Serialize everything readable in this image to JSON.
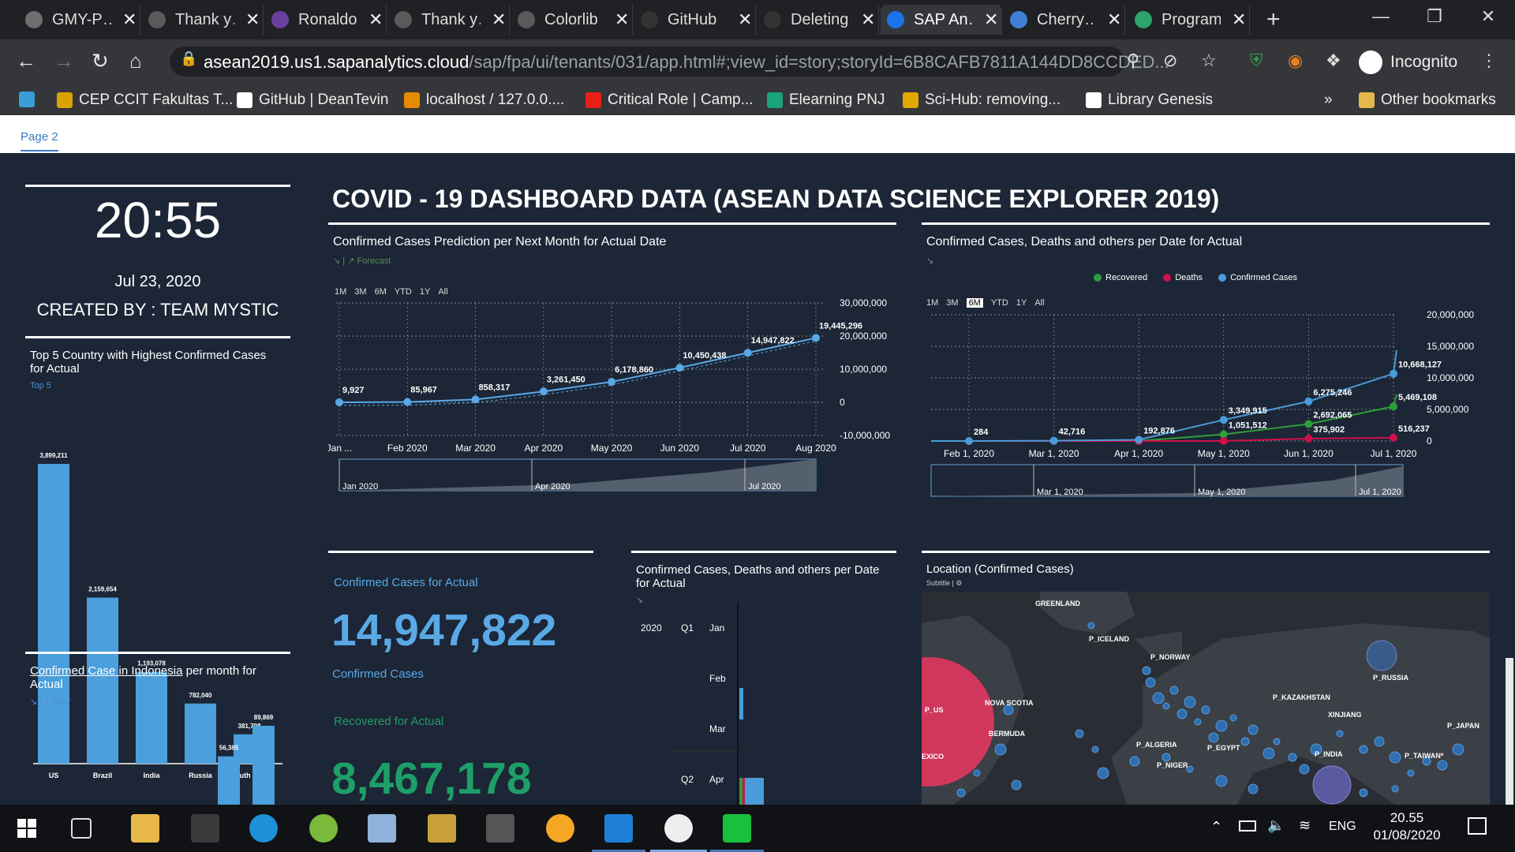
{
  "tabs": [
    {
      "title": "GMY-P…",
      "color": "#6e6e6e"
    },
    {
      "title": "Thank y…",
      "color": "#5a5a5a"
    },
    {
      "title": "Ronaldo…",
      "color": "#6b3fa0"
    },
    {
      "title": "Thank y…",
      "color": "#5a5a5a"
    },
    {
      "title": "Colorlib",
      "color": "#5a5a5a"
    },
    {
      "title": "GitHub",
      "color": "#333"
    },
    {
      "title": "Deleting…",
      "color": "#333"
    },
    {
      "title": "SAP An…",
      "color": "#1a73e8"
    },
    {
      "title": "Cherry…",
      "color": "#3f7fd6"
    },
    {
      "title": "Program…",
      "color": "#2ea36b"
    }
  ],
  "browser": {
    "url_host": "asean2019.us1.sapanalytics.cloud",
    "url_path": "/sap/fpa/ui/tenants/031/app.html#;view_id=story;storyId=6B8CAFB7811A144DD8CCDED...",
    "profile": "Incognito"
  },
  "bookmarks": [
    {
      "label": "CEP CCIT Fakultas T...",
      "color": "#d8a300"
    },
    {
      "label": "GitHub | DeanTevin",
      "color": "#ffffff"
    },
    {
      "label": "localhost / 127.0.0....",
      "color": "#e58b00"
    },
    {
      "label": "Critical Role | Camp...",
      "color": "#e62117"
    },
    {
      "label": "Elearning PNJ",
      "color": "#1aa37a"
    },
    {
      "label": "Sci-Hub: removing...",
      "color": "#e0a800"
    },
    {
      "label": "Library Genesis",
      "color": "#ffffff"
    }
  ],
  "bookmarks_more": "»",
  "other_bookmarks": "Other bookmarks",
  "page_tab": "Page 2",
  "dashboard": {
    "clock": "20:55",
    "date": "Jul 23, 2020",
    "created_by": "CREATED BY : TEAM MYSTIC",
    "title": "COVID - 19 DASHBOARD DATA (ASEAN DATA SCIENCE EXPLORER 2019)",
    "top5": {
      "title": "Top 5 Country with Highest Confirmed Cases for Actual",
      "link": "Top 5"
    },
    "indonesia": {
      "title_link": "Confirmed Case in Indonesia",
      "title_rest": " per month for Actual",
      "filter": "1 Filter"
    },
    "prediction": {
      "title": "Confirmed Cases Prediction per Next Month for Actual Date",
      "forecast": "Forecast",
      "ranges": [
        "1M",
        "3M",
        "6M",
        "YTD",
        "1Y",
        "All"
      ]
    },
    "cdo": {
      "title": "Confirmed Cases, Deaths and others per Date for Actual",
      "ranges": [
        "1M",
        "3M",
        "6M",
        "YTD",
        "1Y",
        "All"
      ],
      "selected_range": "6M"
    },
    "kpi": {
      "confirmed_title": "Confirmed Cases for Actual",
      "confirmed_value": "14,947,822",
      "confirmed_label": "Confirmed Cases",
      "recovered_title": "Recovered for Actual",
      "recovered_value": "8,467,178"
    },
    "small_cdo": {
      "title": "Confirmed Cases, Deaths and others per Date for Actual",
      "rows": [
        {
          "year": "2020",
          "q": "Q1",
          "m": "Jan"
        },
        {
          "year": "",
          "q": "",
          "m": "Feb"
        },
        {
          "year": "",
          "q": "",
          "m": "Mar"
        },
        {
          "year": "",
          "q": "Q2",
          "m": "Apr"
        }
      ]
    },
    "map": {
      "title": "Location (Confirmed Cases)",
      "subtitle": "Subtitle",
      "labels": [
        "GREENLAND",
        "P_ICELAND",
        "P_NORWAY",
        "P_RUSSIA",
        "NOVA SCOTIA",
        "P_US",
        "BERMUDA",
        "P_KAZAKHSTAN",
        "XINJIANG",
        "P_JAPAN",
        "P_ALGERIA",
        "P_EGYPT",
        "P_INDIA",
        "P_TAIWAN*",
        "P_NIGER",
        "EXICO"
      ]
    }
  },
  "chart_data": [
    {
      "type": "bar",
      "title": "Top 5 Country with Highest Confirmed Cases for Actual",
      "categories": [
        "US",
        "Brazil",
        "India",
        "Russia",
        "South Afr..."
      ],
      "values": [
        3899211,
        2159654,
        1193078,
        782040,
        381798
      ],
      "labels": [
        "3,899,211",
        "2,159,654",
        "1,193,078",
        "782,040",
        "381,798"
      ]
    },
    {
      "type": "line",
      "title": "Confirmed Cases Prediction per Next Month for Actual Date",
      "x": [
        "Jan ...",
        "Feb 2020",
        "Mar 2020",
        "Apr 2020",
        "May 2020",
        "Jun 2020",
        "Jul 2020",
        "Aug 2020"
      ],
      "values": [
        9927,
        85967,
        858317,
        3261450,
        6178860,
        10450438,
        14947822,
        19445296
      ],
      "labels": [
        "9,927",
        "85,967",
        "858,317",
        "3,261,450",
        "6,178,860",
        "10,450,438",
        "14,947,822",
        "19,445,296"
      ],
      "yticks": [
        "30,000,000",
        "20,000,000",
        "10,000,000",
        "0",
        "-10,000,000"
      ],
      "ylim": [
        -10000000,
        30000000
      ],
      "navigator": [
        "Jan 2020",
        "Apr 2020",
        "Jul 2020"
      ]
    },
    {
      "type": "line",
      "title": "Confirmed Cases, Deaths and others per Date for Actual",
      "x": [
        "Feb 1, 2020",
        "Mar 1, 2020",
        "Apr 1, 2020",
        "May 1, 2020",
        "Jun 1, 2020",
        "Jul 1, 2020"
      ],
      "ylim": [
        0,
        20000000
      ],
      "yticks": [
        "20,000,000",
        "15,000,000",
        "10,000,000",
        "5,000,000",
        "0"
      ],
      "series": [
        {
          "name": "Recovered",
          "color": "#2e9e3a",
          "values": [
            0,
            0,
            5000,
            1051512,
            2692065,
            5469108
          ],
          "labels": [
            "",
            "",
            "",
            "1,051,512",
            "2,692,065",
            "5,469,108"
          ]
        },
        {
          "name": "Deaths",
          "color": "#d0104a",
          "values": [
            0,
            0,
            0,
            0,
            375902,
            516237
          ],
          "labels": [
            "",
            "",
            "",
            "",
            "375,902",
            "516,237"
          ]
        },
        {
          "name": "Confirmed Cases",
          "color": "#4a9bd9",
          "values": [
            284,
            42716,
            192876,
            3349915,
            6275246,
            10668127
          ],
          "labels": [
            "284",
            "42,716",
            "192,876",
            "3,349,915",
            "6,275,246",
            "10,668,127"
          ]
        }
      ],
      "navigator": [
        "Mar 1, 2020",
        "May 1, 2020",
        "Jul 1, 2020"
      ]
    },
    {
      "type": "bar",
      "title": "Confirmed Case in Indonesia per month for Actual",
      "values": [
        56385,
        89869
      ],
      "labels": [
        "56,385",
        "89,869"
      ]
    }
  ],
  "taskbar": {
    "language": "ENG",
    "time": "20.55",
    "date": "01/08/2020"
  }
}
